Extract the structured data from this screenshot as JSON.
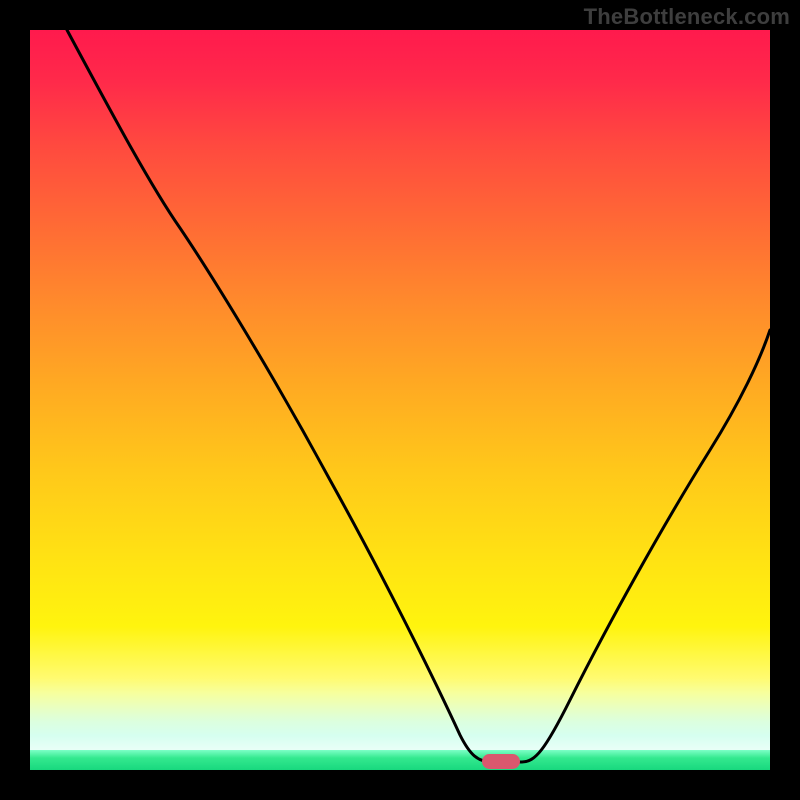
{
  "watermark": "TheBottleneck.com",
  "chart_data": {
    "type": "line",
    "title": "",
    "xlabel": "",
    "ylabel": "",
    "xlim": [
      0,
      100
    ],
    "ylim": [
      0,
      100
    ],
    "grid": false,
    "legend": false,
    "background": "red-yellow-green vertical gradient (bottleneck heatmap)",
    "series": [
      {
        "name": "bottleneck-curve",
        "x": [
          5,
          12,
          20,
          25,
          30,
          35,
          40,
          45,
          50,
          55,
          58,
          60,
          63,
          66,
          70,
          75,
          80,
          85,
          90,
          95,
          100
        ],
        "y": [
          100,
          88,
          74,
          67,
          59,
          51,
          43,
          35,
          26,
          16,
          8,
          3,
          0.5,
          0.5,
          3,
          12,
          23,
          34,
          44,
          53,
          60
        ]
      }
    ],
    "marker": {
      "x": 64,
      "y": 0.5,
      "shape": "pill",
      "color": "#d9586e"
    },
    "annotations": []
  }
}
